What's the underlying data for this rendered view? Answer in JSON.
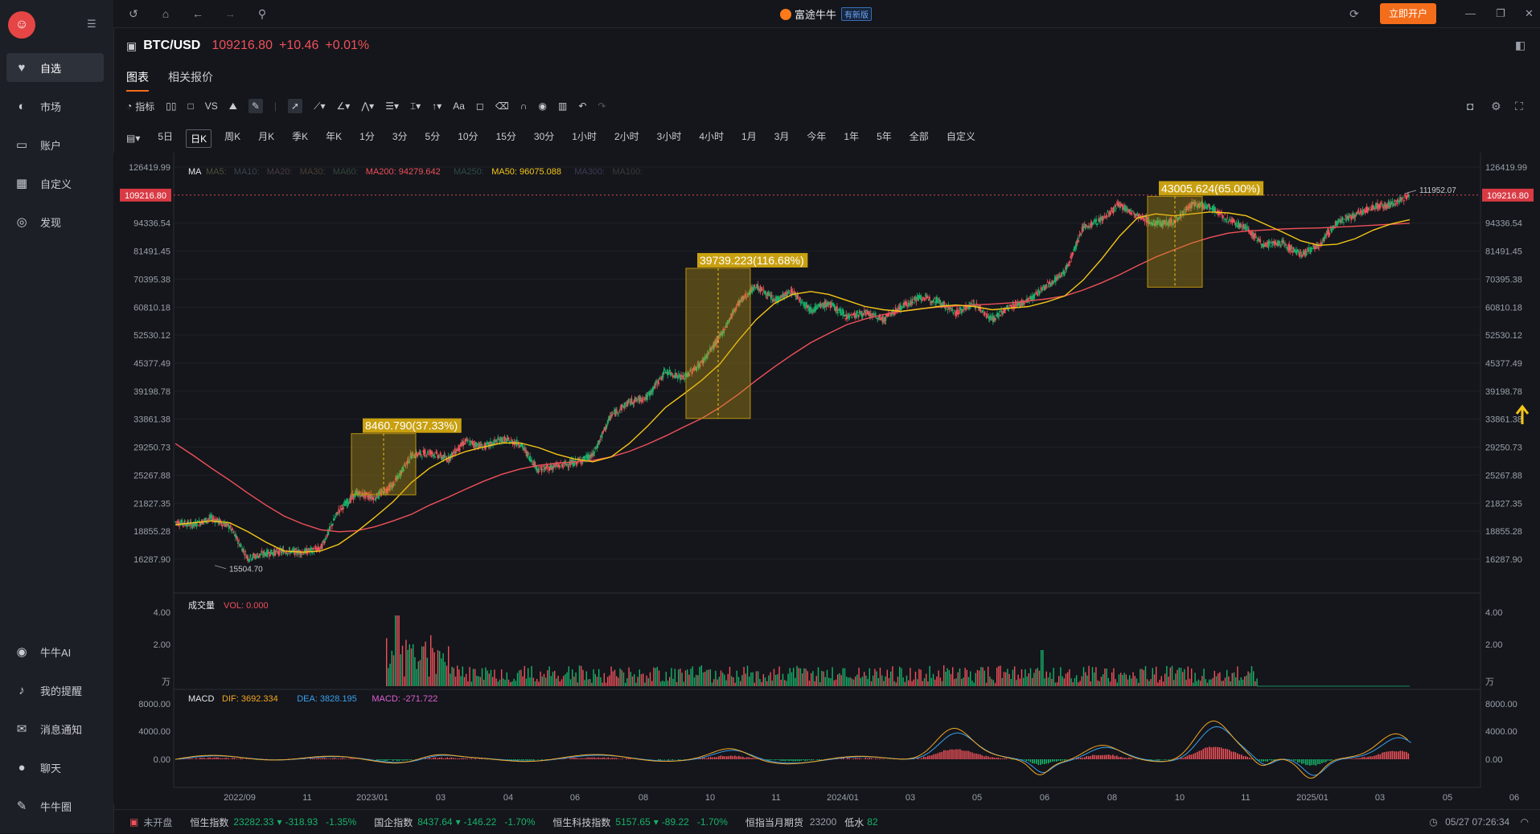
{
  "sidebar": {
    "items": [
      {
        "label": "自选",
        "icon": "heart-icon"
      },
      {
        "label": "市场",
        "icon": "planet-icon"
      },
      {
        "label": "账户",
        "icon": "wallet-icon"
      },
      {
        "label": "自定义",
        "icon": "grid-icon"
      },
      {
        "label": "发现",
        "icon": "compass-icon"
      }
    ],
    "bottom_items": [
      {
        "label": "牛牛AI",
        "icon": "robot-icon"
      },
      {
        "label": "我的提醒",
        "icon": "bell-icon"
      },
      {
        "label": "消息通知",
        "icon": "mail-icon"
      },
      {
        "label": "聊天",
        "icon": "chat-icon"
      },
      {
        "label": "牛牛圈",
        "icon": "feather-icon"
      }
    ]
  },
  "topbar": {
    "brand": "富途牛牛",
    "tag": "有新版",
    "open_account": "立即开户"
  },
  "symbol": {
    "name": "BTC/USD",
    "price": "109216.80",
    "change": "+10.46",
    "change_pct": "+0.01%"
  },
  "tabs": [
    {
      "label": "图表"
    },
    {
      "label": "相关报价"
    }
  ],
  "toolbar": {
    "indicator": "指标",
    "vs": "VS",
    "text_tool": "Aa"
  },
  "periods": [
    "5日",
    "日K",
    "周K",
    "月K",
    "季K",
    "年K",
    "1分",
    "3分",
    "5分",
    "10分",
    "15分",
    "30分",
    "1小时",
    "2小时",
    "3小时",
    "4小时",
    "1月",
    "3月",
    "今年",
    "1年",
    "5年",
    "全部",
    "自定义"
  ],
  "selected_period": "日K",
  "ma_legend": {
    "label": "MA",
    "items": [
      {
        "text": "MA5:",
        "color": "#4e4e3a"
      },
      {
        "text": "MA10:",
        "color": "#3a4450"
      },
      {
        "text": "MA20:",
        "color": "#4a3a48"
      },
      {
        "text": "MA30:",
        "color": "#4a3f34"
      },
      {
        "text": "MA60:",
        "color": "#34463c"
      },
      {
        "text": "MA200: 94279.642",
        "color": "#f0505a"
      },
      {
        "text": "MA250:",
        "color": "#2f4a4a"
      },
      {
        "text": "MA50: 96075.088",
        "color": "#f5c518"
      },
      {
        "text": "MA300:",
        "color": "#3c3a55"
      },
      {
        "text": "MA100:",
        "color": "#3a3a3a"
      }
    ]
  },
  "chart_data": [
    {
      "type": "candlestick",
      "title": "BTC/USD",
      "y_ticks": [
        "126419.99",
        "109216.80",
        "94336.54",
        "81491.45",
        "70395.38",
        "60810.18",
        "52530.12",
        "45377.49",
        "39198.78",
        "33861.38",
        "29250.73",
        "25267.88",
        "21827.35",
        "18855.28",
        "16287.90"
      ],
      "x_ticks": [
        "2022/09",
        "11",
        "2023/01",
        "03",
        "04",
        "06",
        "08",
        "10",
        "11",
        "2024/01",
        "03",
        "05",
        "06",
        "08",
        "10",
        "11",
        "2025/01",
        "03",
        "05",
        "06"
      ],
      "last_price": "109216.80",
      "high_label": "111952.07",
      "low_label": "15504.70",
      "close_series": [
        19800,
        19500,
        20200,
        19300,
        16400,
        16800,
        17000,
        16900,
        17200,
        21000,
        23000,
        22500,
        24000,
        28000,
        28500,
        27500,
        30200,
        29300,
        30500,
        29800,
        26000,
        26500,
        27000,
        28000,
        34500,
        37000,
        38000,
        43500,
        42000,
        45500,
        52000,
        62000,
        68000,
        63000,
        66000,
        60000,
        62000,
        58000,
        59000,
        57000,
        61000,
        64000,
        63000,
        59000,
        62000,
        57000,
        61000,
        63000,
        68000,
        73000,
        92000,
        96000,
        104000,
        98000,
        94000,
        95000,
        104000,
        103000,
        96000,
        92000,
        84000,
        85000,
        80000,
        84000,
        95000,
        98000,
        103000,
        104000,
        109216.8
      ],
      "ma50_series": [
        19500,
        19700,
        19900,
        19700,
        18800,
        17800,
        17000,
        16900,
        17000,
        17600,
        18800,
        20300,
        22000,
        24300,
        26200,
        27600,
        28600,
        29300,
        29900,
        29900,
        29200,
        28200,
        27500,
        27100,
        27800,
        29800,
        32600,
        36000,
        38600,
        41500,
        45200,
        51000,
        57000,
        62000,
        65000,
        66000,
        65000,
        63000,
        61000,
        60000,
        59500,
        60200,
        61000,
        61500,
        61000,
        60000,
        60500,
        61000,
        62500,
        64500,
        70000,
        78000,
        88000,
        97000,
        99000,
        98000,
        99000,
        100000,
        99500,
        98000,
        94000,
        90000,
        86000,
        84000,
        84500,
        87000,
        91000,
        94000,
        96075
      ],
      "ma200_series": [
        29800,
        28000,
        26200,
        24600,
        23000,
        21600,
        20400,
        19600,
        19000,
        18800,
        18900,
        19300,
        19900,
        20600,
        21600,
        22500,
        23500,
        24500,
        25400,
        26100,
        26600,
        26900,
        27100,
        27300,
        27800,
        28600,
        29700,
        31000,
        32500,
        34000,
        36000,
        38500,
        41500,
        44500,
        47500,
        50500,
        53000,
        55500,
        57200,
        58500,
        59500,
        60300,
        60800,
        61200,
        61500,
        61800,
        62200,
        62800,
        63500,
        64500,
        66500,
        69000,
        72000,
        75500,
        79000,
        82000,
        85000,
        87500,
        89500,
        90500,
        91000,
        91500,
        91800,
        92000,
        92400,
        92800,
        93300,
        93800,
        94279.6
      ],
      "annotations": [
        {
          "text": "8460.790(37.33%)"
        },
        {
          "text": "39739.223(116.68%)"
        },
        {
          "text": "43005.624(65.00%)"
        }
      ]
    },
    {
      "type": "bar",
      "title": "成交量",
      "legend": "VOL: 0.000",
      "y_ticks": [
        "4.00",
        "2.00",
        "万"
      ]
    },
    {
      "type": "line",
      "title": "MACD",
      "legend": [
        {
          "text": "DIF: 3692.334",
          "color": "#f5a623"
        },
        {
          "text": "DEA: 3828.195",
          "color": "#3aa0f0"
        },
        {
          "text": "MACD: -271.722",
          "color": "#e05fd6"
        }
      ],
      "y_ticks": [
        "8000.00",
        "4000.00",
        "0.00"
      ]
    }
  ],
  "status": {
    "market": "未开盘",
    "indices": [
      {
        "name": "恒生指数",
        "value": "23282.33",
        "change": "-318.93",
        "pct": "-1.35%"
      },
      {
        "name": "国企指数",
        "value": "8437.64",
        "change": "-146.22",
        "pct": "-1.70%"
      },
      {
        "name": "恒生科技指数",
        "value": "5157.65",
        "change": "-89.22",
        "pct": "-1.70%"
      }
    ],
    "futures": {
      "name": "恒指当月期货",
      "value": "23200"
    },
    "premium": {
      "name": "低水",
      "value": "82"
    },
    "time": "05/27 07:26:34"
  },
  "colors": {
    "accent": "#f46d1b",
    "up": "#f0505a",
    "down": "#17b26a",
    "ma50": "#f5c518",
    "ma200": "#f0505a"
  }
}
